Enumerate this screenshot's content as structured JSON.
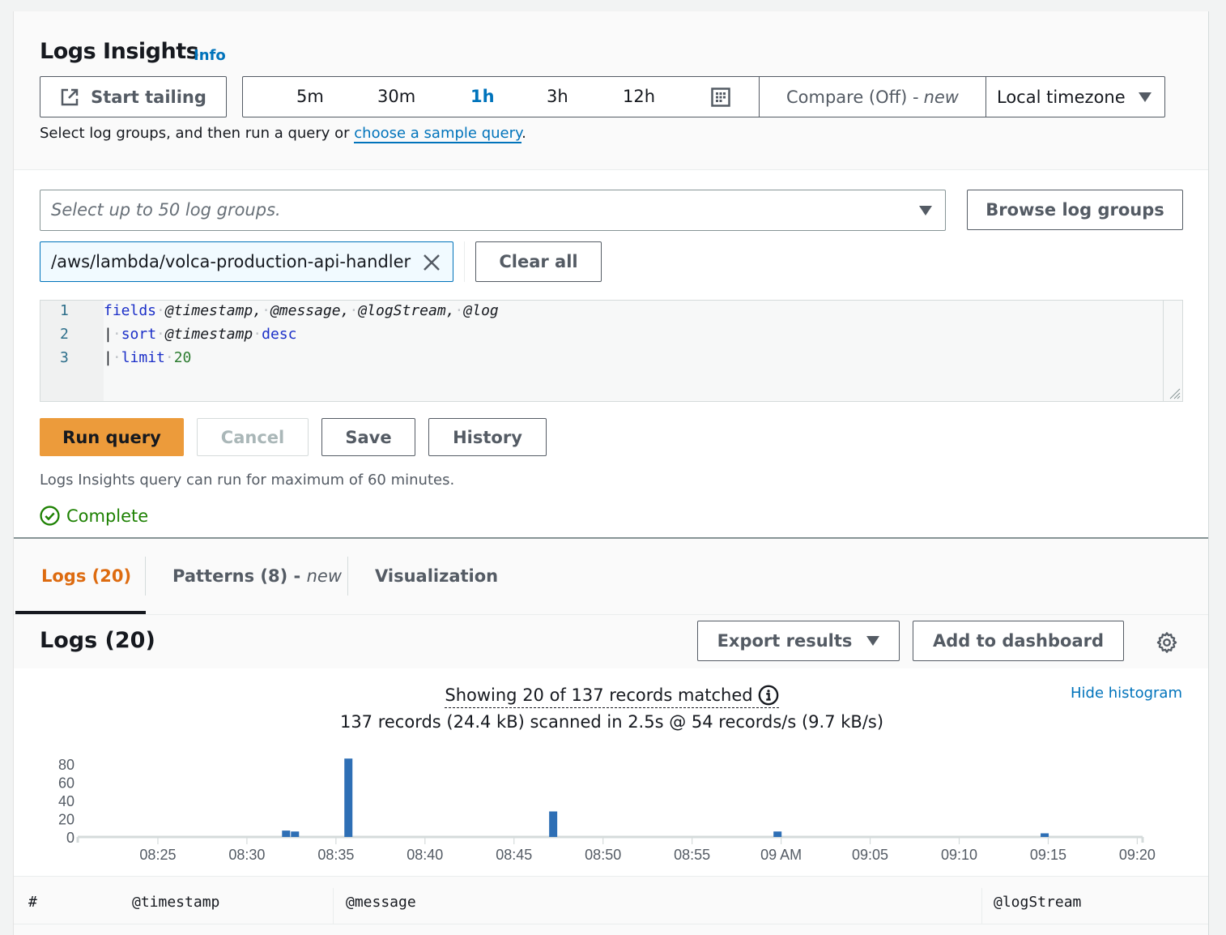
{
  "header": {
    "title": "Logs Insights",
    "info_link": "Info",
    "start_tailing": "Start tailing",
    "time_ranges": [
      "5m",
      "30m",
      "1h",
      "3h",
      "12h"
    ],
    "active_time_range": "1h",
    "compare_label": "Compare (Off) -",
    "compare_new": "new",
    "timezone": "Local timezone",
    "hint_prefix": "Select log groups, and then run a query or ",
    "hint_link": "choose a sample query",
    "hint_suffix": "."
  },
  "query": {
    "log_group_placeholder": "Select up to 50 log groups.",
    "browse_label": "Browse log groups",
    "selected_log_group": "/aws/lambda/volca-production-api-handler",
    "clear_all": "Clear all",
    "lines": [
      "fields @timestamp, @message, @logStream, @log",
      "| sort @timestamp desc",
      "| limit 20"
    ],
    "run_label": "Run query",
    "cancel_label": "Cancel",
    "save_label": "Save",
    "history_label": "History",
    "note": "Logs Insights query can run for maximum of 60 minutes.",
    "status": "Complete",
    "status_color": "#1d8102"
  },
  "tabs": [
    {
      "label": "Logs (20)",
      "suffix": "",
      "active": true
    },
    {
      "label": "Patterns (8) - ",
      "suffix": "new",
      "active": false
    },
    {
      "label": "Visualization",
      "suffix": "",
      "active": false
    }
  ],
  "results": {
    "title": "Logs (20)",
    "export_label": "Export results",
    "dashboard_label": "Add to dashboard",
    "showing": "Showing 20 of 137 records matched",
    "scanned": "137 records (24.4 kB) scanned in 2.5s @ 54 records/s (9.7 kB/s)",
    "hide_histogram": "Hide histogram",
    "columns": [
      "#",
      "@timestamp",
      "@message",
      "@logStream"
    ]
  },
  "colors": {
    "accent": "#0073bb",
    "primary_button": "#ec9b3b",
    "active_tab": "#dd6b10",
    "bar": "#2e6fb5"
  },
  "chart_data": {
    "type": "bar",
    "title": "",
    "xlabel": "",
    "ylabel": "",
    "ylim": [
      0,
      80
    ],
    "y_ticks": [
      "0",
      "20",
      "40",
      "60",
      "80"
    ],
    "x_range_minutes": [
      20.5,
      80.3
    ],
    "x_ticks": [
      {
        "label": "08:25",
        "minute": 25
      },
      {
        "label": "08:30",
        "minute": 30
      },
      {
        "label": "08:35",
        "minute": 35
      },
      {
        "label": "08:40",
        "minute": 40
      },
      {
        "label": "08:45",
        "minute": 45
      },
      {
        "label": "08:50",
        "minute": 50
      },
      {
        "label": "08:55",
        "minute": 55
      },
      {
        "label": "09 AM",
        "minute": 60
      },
      {
        "label": "09:05",
        "minute": 65
      },
      {
        "label": "09:10",
        "minute": 70
      },
      {
        "label": "09:15",
        "minute": 75
      },
      {
        "label": "09:20",
        "minute": 80
      }
    ],
    "bars": [
      {
        "minute": 32.2,
        "value": 7
      },
      {
        "minute": 32.7,
        "value": 6
      },
      {
        "minute": 35.7,
        "value": 86
      },
      {
        "minute": 47.2,
        "value": 28
      },
      {
        "minute": 59.8,
        "value": 6
      },
      {
        "minute": 74.8,
        "value": 4
      }
    ],
    "grid": false,
    "legend": "none"
  }
}
